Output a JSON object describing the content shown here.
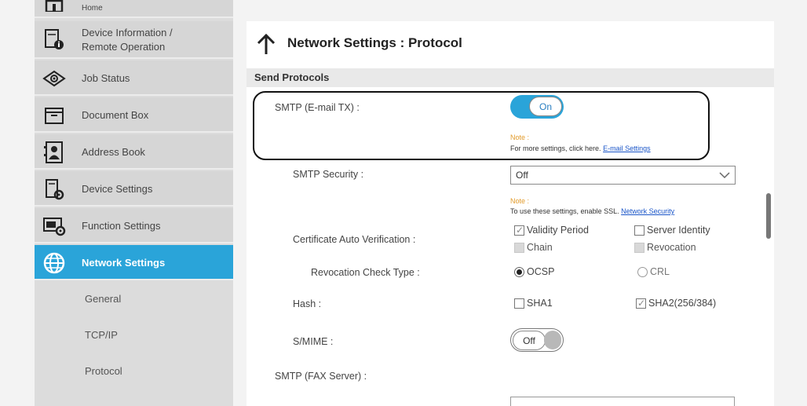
{
  "sidebar": {
    "items": [
      {
        "label": "Home",
        "icon": "home-icon"
      },
      {
        "label": "Device Information / Remote Operation",
        "icon": "device-info-icon"
      },
      {
        "label": "Job Status",
        "icon": "eye-icon"
      },
      {
        "label": "Document Box",
        "icon": "folder-icon"
      },
      {
        "label": "Address Book",
        "icon": "address-book-icon"
      },
      {
        "label": "Device Settings",
        "icon": "device-settings-icon"
      },
      {
        "label": "Function Settings",
        "icon": "function-settings-icon"
      },
      {
        "label": "Network Settings",
        "icon": "globe-icon"
      }
    ],
    "sub_items": [
      "General",
      "TCP/IP",
      "Protocol"
    ],
    "active_color": "#2aa4d9"
  },
  "main": {
    "title": "Network Settings : Protocol",
    "section": "Send Protocols",
    "smtp_label": "SMTP (E-mail TX) :",
    "smtp_toggle": "On",
    "note1_label": "Note :",
    "note1_text": "For more settings, click here.",
    "note1_link": "E-mail Settings",
    "smtp_security_label": "SMTP Security :",
    "smtp_security_value": "Off",
    "note2_label": "Note :",
    "note2_text": "To use these settings, enable SSL.",
    "note2_link": "Network Security",
    "cert_label": "Certificate Auto Verification :",
    "cert_options": [
      "Validity Period",
      "Server Identity",
      "Chain",
      "Revocation"
    ],
    "revocation_label": "Revocation Check Type :",
    "revocation_options": [
      "OCSP",
      "CRL"
    ],
    "hash_label": "Hash :",
    "hash_options": [
      "SHA1",
      "SHA2(256/384)"
    ],
    "smime_label": "S/MIME :",
    "smime_toggle": "Off",
    "smtp_fax_label": "SMTP (FAX Server) :"
  }
}
